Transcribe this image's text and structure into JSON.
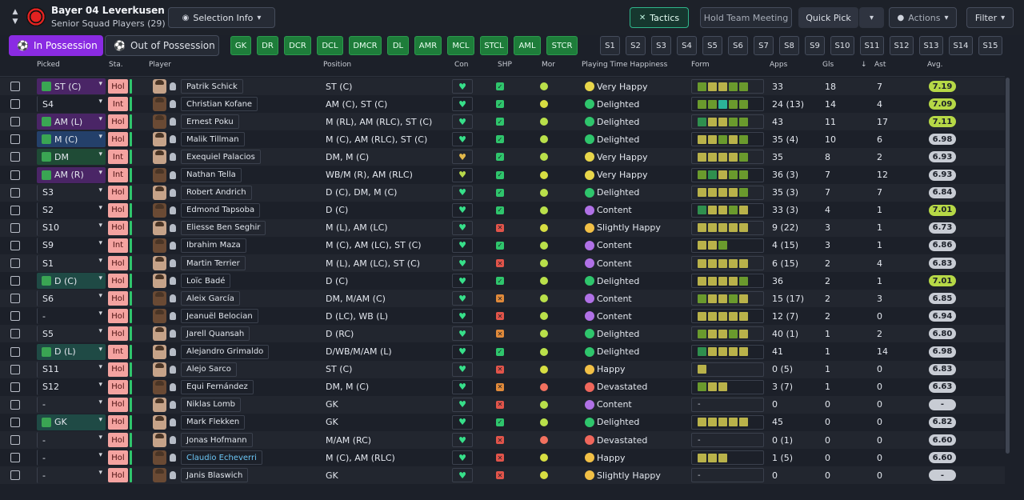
{
  "header": {
    "club_name": "Bayer 04 Leverkusen",
    "squad_name": "Senior Squad Players (29)",
    "selection_info": "Selection Info",
    "tactics": "Tactics",
    "hold_team_meeting": "Hold Team Meeting",
    "quick_pick": "Quick Pick",
    "actions": "Actions",
    "filter": "Filter"
  },
  "possession": {
    "in": "In Possession",
    "out": "Out of Possession"
  },
  "position_chips": [
    "GK",
    "DR",
    "DCR",
    "DCL",
    "DMCR",
    "DL",
    "AMR",
    "MCL",
    "STCL",
    "AML",
    "STCR"
  ],
  "selection_chips": [
    "S1",
    "S2",
    "S3",
    "S4",
    "S5",
    "S6",
    "S7",
    "S8",
    "S9",
    "S10",
    "S11",
    "S12",
    "S13",
    "S14",
    "S15"
  ],
  "columns": {
    "picked": "Picked",
    "sta": "Sta.",
    "player": "Player",
    "position": "Position",
    "con": "Con",
    "shp": "SHP",
    "mor": "Mor",
    "happiness": "Playing Time Happiness",
    "form": "Form",
    "apps": "Apps",
    "gls": "Gls",
    "ast": "Ast",
    "avg": "Avg."
  },
  "colors": {
    "accent_purple": "#8a2be2",
    "tactics_green": "#2fb58b",
    "position_chip": "#1e7d3a",
    "status_pink": "#f4a3a0"
  },
  "players": [
    {
      "picked": "ST (C)",
      "picked_style": "purple",
      "sta": "Hol",
      "name": "Patrik Schick",
      "position": "ST (C)",
      "con": "good",
      "shp": "g",
      "mor": "g",
      "happiness": "Very Happy",
      "hp": "vh",
      "form": [
        "lg",
        "y",
        "y",
        "lg",
        "lg"
      ],
      "apps": "33",
      "gls": "18",
      "ast": "7",
      "avg": "7.19",
      "avg_high": true
    },
    {
      "picked": "S4",
      "picked_style": "plain",
      "sta": "Int",
      "name": "Christian Kofane",
      "position": "AM (C), ST (C)",
      "con": "good",
      "shp": "g",
      "mor": "y",
      "happiness": "Delighted",
      "hp": "d",
      "form": [
        "lg",
        "lg",
        "t",
        "lg",
        "lg"
      ],
      "apps": "24 (13)",
      "gls": "14",
      "ast": "4",
      "avg": "7.09",
      "avg_high": true
    },
    {
      "picked": "AM (L)",
      "picked_style": "purple",
      "sta": "Hol",
      "name": "Ernest Poku",
      "position": "M (RL), AM (RLC), ST (C)",
      "con": "good",
      "shp": "g",
      "mor": "g",
      "happiness": "Delighted",
      "hp": "d",
      "form": [
        "dg",
        "y",
        "y",
        "lg",
        "lg"
      ],
      "apps": "43",
      "gls": "11",
      "ast": "17",
      "avg": "7.11",
      "avg_high": true
    },
    {
      "picked": "M (C)",
      "picked_style": "blue",
      "sta": "Hol",
      "name": "Malik Tillman",
      "position": "M (C), AM (RLC), ST (C)",
      "con": "good",
      "shp": "g",
      "mor": "g",
      "happiness": "Delighted",
      "hp": "d",
      "form": [
        "y",
        "y",
        "lg",
        "y",
        "lg"
      ],
      "apps": "35 (4)",
      "gls": "10",
      "ast": "6",
      "avg": "6.98",
      "avg_high": false
    },
    {
      "picked": "DM",
      "picked_style": "green",
      "sta": "Int",
      "name": "Exequiel Palacios",
      "position": "DM, M (C)",
      "con": "warn",
      "shp": "g",
      "mor": "g",
      "happiness": "Very Happy",
      "hp": "vh",
      "form": [
        "y",
        "y",
        "y",
        "y",
        "lg"
      ],
      "apps": "35",
      "gls": "8",
      "ast": "2",
      "avg": "6.93",
      "avg_high": false
    },
    {
      "picked": "AM (R)",
      "picked_style": "purple",
      "sta": "Int",
      "name": "Nathan Tella",
      "position": "WB/M (R), AM (RLC)",
      "con": "mid",
      "shp": "g",
      "mor": "y",
      "happiness": "Very Happy",
      "hp": "vh",
      "form": [
        "lg",
        "dg",
        "y",
        "lg",
        "lg"
      ],
      "apps": "36 (3)",
      "gls": "7",
      "ast": "12",
      "avg": "6.93",
      "avg_high": false
    },
    {
      "picked": "S3",
      "picked_style": "plain",
      "sta": "Hol",
      "name": "Robert Andrich",
      "position": "D (C), DM, M (C)",
      "con": "good",
      "shp": "g",
      "mor": "g",
      "happiness": "Delighted",
      "hp": "d",
      "form": [
        "y",
        "y",
        "y",
        "y",
        "lg"
      ],
      "apps": "35 (3)",
      "gls": "7",
      "ast": "7",
      "avg": "6.84",
      "avg_high": false
    },
    {
      "picked": "S2",
      "picked_style": "plain",
      "sta": "Hol",
      "name": "Edmond Tapsoba",
      "position": "D (C)",
      "con": "good",
      "shp": "g",
      "mor": "g",
      "happiness": "Content",
      "hp": "c",
      "form": [
        "dg",
        "y",
        "y",
        "lg",
        "y"
      ],
      "apps": "33 (3)",
      "gls": "4",
      "ast": "1",
      "avg": "7.01",
      "avg_high": true
    },
    {
      "picked": "S10",
      "picked_style": "plain",
      "sta": "Hol",
      "name": "Eliesse Ben Seghir",
      "position": "M (L), AM (LC)",
      "con": "good",
      "shp": "r",
      "mor": "y",
      "happiness": "Slightly Happy",
      "hp": "h",
      "form": [
        "y",
        "y",
        "y",
        "y",
        "y"
      ],
      "apps": "9 (22)",
      "gls": "3",
      "ast": "1",
      "avg": "6.73",
      "avg_high": false
    },
    {
      "picked": "S9",
      "picked_style": "plain",
      "sta": "Int",
      "name": "Ibrahim Maza",
      "position": "M (C), AM (LC), ST (C)",
      "con": "good",
      "shp": "g",
      "mor": "g",
      "happiness": "Content",
      "hp": "c",
      "form": [
        "y",
        "y",
        "lg"
      ],
      "apps": "4 (15)",
      "gls": "3",
      "ast": "1",
      "avg": "6.86",
      "avg_high": false
    },
    {
      "picked": "S1",
      "picked_style": "plain",
      "sta": "Hol",
      "name": "Martin Terrier",
      "position": "M (L), AM (LC), ST (C)",
      "con": "good",
      "shp": "r",
      "mor": "g",
      "happiness": "Content",
      "hp": "c",
      "form": [
        "y",
        "y",
        "y",
        "y",
        "y"
      ],
      "apps": "6 (15)",
      "gls": "2",
      "ast": "4",
      "avg": "6.83",
      "avg_high": false
    },
    {
      "picked": "D (C)",
      "picked_style": "teal",
      "sta": "Hol",
      "name": "Loïc Badé",
      "position": "D (C)",
      "con": "good",
      "shp": "g",
      "mor": "g",
      "happiness": "Delighted",
      "hp": "d",
      "form": [
        "y",
        "y",
        "y",
        "y",
        "lg"
      ],
      "apps": "36",
      "gls": "2",
      "ast": "1",
      "avg": "7.01",
      "avg_high": true
    },
    {
      "picked": "S6",
      "picked_style": "plain",
      "sta": "Hol",
      "name": "Aleix García",
      "position": "DM, M/AM (C)",
      "con": "good",
      "shp": "o",
      "mor": "g",
      "happiness": "Content",
      "hp": "c",
      "form": [
        "lg",
        "y",
        "y",
        "lg",
        "y"
      ],
      "apps": "15 (17)",
      "gls": "2",
      "ast": "3",
      "avg": "6.85",
      "avg_high": false
    },
    {
      "picked": "-",
      "picked_style": "plain",
      "sta": "Hol",
      "name": "Jeanuël Belocian",
      "position": "D (LC), WB (L)",
      "con": "good",
      "shp": "r",
      "mor": "g",
      "happiness": "Content",
      "hp": "c",
      "form": [
        "y",
        "y",
        "y",
        "y",
        "y"
      ],
      "apps": "12 (7)",
      "gls": "2",
      "ast": "0",
      "avg": "6.94",
      "avg_high": false
    },
    {
      "picked": "S5",
      "picked_style": "plain",
      "sta": "Hol",
      "name": "Jarell Quansah",
      "position": "D (RC)",
      "con": "good",
      "shp": "o",
      "mor": "g",
      "happiness": "Delighted",
      "hp": "d",
      "form": [
        "lg",
        "y",
        "y",
        "lg",
        "y"
      ],
      "apps": "40 (1)",
      "gls": "1",
      "ast": "2",
      "avg": "6.80",
      "avg_high": false
    },
    {
      "picked": "D (L)",
      "picked_style": "teal",
      "sta": "Int",
      "name": "Alejandro Grimaldo",
      "position": "D/WB/M/AM (L)",
      "con": "good",
      "shp": "g",
      "mor": "g",
      "happiness": "Delighted",
      "hp": "d",
      "form": [
        "dg",
        "y",
        "y",
        "y",
        "y"
      ],
      "apps": "41",
      "gls": "1",
      "ast": "14",
      "avg": "6.98",
      "avg_high": false
    },
    {
      "picked": "S11",
      "picked_style": "plain",
      "sta": "Hol",
      "name": "Alejo Sarco",
      "position": "ST (C)",
      "con": "good",
      "shp": "r",
      "mor": "y",
      "happiness": "Happy",
      "hp": "h",
      "form": [
        "y"
      ],
      "apps": "0 (5)",
      "gls": "1",
      "ast": "0",
      "avg": "6.83",
      "avg_high": false
    },
    {
      "picked": "S12",
      "picked_style": "plain",
      "sta": "Hol",
      "name": "Equi Fernández",
      "position": "DM, M (C)",
      "con": "good",
      "shp": "o",
      "mor": "r",
      "happiness": "Devastated",
      "hp": "dev",
      "form": [
        "lg",
        "y",
        "y"
      ],
      "apps": "3 (7)",
      "gls": "1",
      "ast": "0",
      "avg": "6.63",
      "avg_high": false
    },
    {
      "picked": "-",
      "picked_style": "plain",
      "sta": "Hol",
      "name": "Niklas Lomb",
      "position": "GK",
      "con": "good",
      "shp": "r",
      "mor": "g",
      "happiness": "Content",
      "hp": "c",
      "form": [],
      "apps": "0",
      "gls": "0",
      "ast": "0",
      "avg": "-",
      "avg_high": false
    },
    {
      "picked": "GK",
      "picked_style": "teal",
      "sta": "Hol",
      "name": "Mark Flekken",
      "position": "GK",
      "con": "good",
      "shp": "g",
      "mor": "g",
      "happiness": "Delighted",
      "hp": "d",
      "form": [
        "y",
        "y",
        "y",
        "y",
        "y"
      ],
      "apps": "45",
      "gls": "0",
      "ast": "0",
      "avg": "6.82",
      "avg_high": false
    },
    {
      "picked": "-",
      "picked_style": "plain",
      "sta": "Hol",
      "name": "Jonas Hofmann",
      "position": "M/AM (RC)",
      "con": "good",
      "shp": "r",
      "mor": "r",
      "happiness": "Devastated",
      "hp": "dev",
      "form": [],
      "apps": "0 (1)",
      "gls": "0",
      "ast": "0",
      "avg": "6.60",
      "avg_high": false
    },
    {
      "picked": "-",
      "picked_style": "plain",
      "sta": "Hol",
      "name": "Claudio Echeverri",
      "position": "M (C), AM (RLC)",
      "con": "good",
      "shp": "r",
      "mor": "y",
      "happiness": "Happy",
      "hp": "h",
      "form": [
        "y",
        "y",
        "y"
      ],
      "apps": "1 (5)",
      "gls": "0",
      "ast": "0",
      "avg": "6.60",
      "avg_high": false,
      "link": true
    },
    {
      "picked": "-",
      "picked_style": "plain",
      "sta": "Hol",
      "name": "Janis Blaswich",
      "position": "GK",
      "con": "good",
      "shp": "r",
      "mor": "y",
      "happiness": "Slightly Happy",
      "hp": "h",
      "form": [],
      "apps": "0",
      "gls": "0",
      "ast": "0",
      "avg": "-",
      "avg_high": false
    }
  ]
}
